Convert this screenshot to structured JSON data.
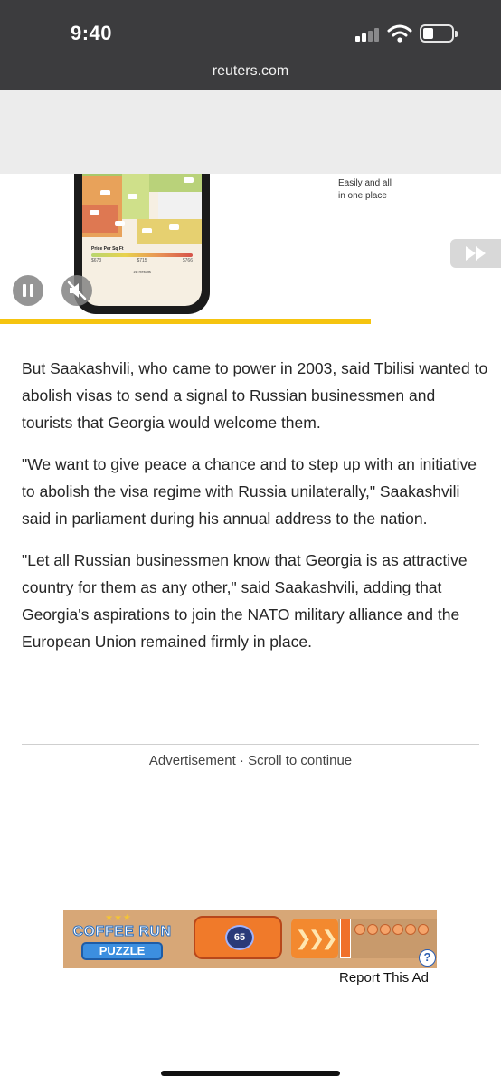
{
  "status_bar": {
    "time": "9:40",
    "signal_icon": "cellular-signal-icon",
    "wifi_icon": "wifi-icon",
    "battery_icon": "battery-icon",
    "battery_level": 0.3
  },
  "address_bar": {
    "url": "reuters.com"
  },
  "video_ad": {
    "caption_line1": "Easily and all",
    "caption_line2": "in one place",
    "legend_label": "Price Per Sq Ft",
    "legend_min": "$673",
    "legend_mid": "$715",
    "legend_max": "$766",
    "results_text": "1st Results",
    "pause_icon": "pause-icon",
    "mute_icon": "muted-speaker-icon",
    "skip_icon": "fast-forward-icon",
    "progress": 0.74,
    "accent_color": "#f5c40f"
  },
  "article": {
    "paragraphs": [
      "But Saakashvili, who came to power in 2003, said Tbilisi wanted to abolish visas to send a signal to Russian businessmen and tourists that Georgia would welcome them.",
      "\"We want to give peace a chance and to step up with an initiative to abolish the visa regime with Russia unilaterally,\" Saakashvili said in parliament during his annual address to the nation.",
      "\"Let all Russian businessmen know that Georgia is as attractive country for them as any other,\" said Saakashvili, adding that Georgia's aspirations to join the NATO military alliance and the European Union remained firmly in place."
    ]
  },
  "ad_notice": {
    "label": "Advertisement · Scroll to continue"
  },
  "banner_ad": {
    "logo_line1": "COFFEE RUN",
    "logo_line2": "PUZZLE",
    "bomb_count": "65",
    "help_icon": "question-mark-icon",
    "report_label": "Report This Ad"
  }
}
